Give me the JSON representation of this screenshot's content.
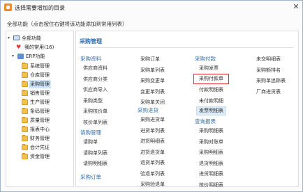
{
  "window": {
    "title": "选择需要增加的目录",
    "close_label": "✕"
  },
  "subtitle": "全部功能（点击按住右键将该功能添加到常用列表）",
  "tree": {
    "root_label": "全部功能",
    "favorites_label": "我的常用(16)",
    "erp_label": "ERP功能",
    "modules": [
      "系统管理",
      "仓库管理",
      "采购管理",
      "销售管理",
      "生产管理",
      "条码管理",
      "质量管理",
      "报表中心",
      "财务管理",
      "会计凭证",
      "资金管理"
    ],
    "selected_index": 2
  },
  "content": {
    "heading": "采购管理",
    "groups": [
      {
        "title": "采购资料",
        "items": [
          "供应商资料",
          "供应商分类",
          "供应商导入",
          "采购类型",
          "采购核价单",
          "核价单列表"
        ]
      },
      {
        "title": "请购管理",
        "items": [
          "请购单",
          "请购单列表",
          "请购明细表"
        ]
      },
      {
        "title": "采购订单",
        "items": []
      },
      {
        "title": "",
        "items": [
          "采购订单",
          "采购单列表",
          "采购变更单",
          "变更单列表",
          "采购单关闭"
        ]
      },
      {
        "title": "采购进货",
        "items": [
          "采购进货单",
          "进货单列表",
          "进货明细表",
          "进货退货单",
          "退货单列表",
          "验退单列表",
          "采购验退单"
        ]
      },
      {
        "title": "采购付款",
        "items": [
          "采购发票",
          "采购付款单",
          "付款明细表",
          "未付款明细",
          "发票明细表"
        ]
      },
      {
        "title": "查询报表",
        "items": [
          "采购明细表",
          "采购对账单",
          "采购明细表",
          "退货明细表",
          "进货明细表",
          "核价明细表"
        ]
      },
      {
        "title": "",
        "items": [
          "未交明细表",
          "采购额排名",
          "采购单追踪表",
          "厂商进货表"
        ]
      }
    ],
    "highlighted_item": "发票明细表",
    "outlined_item": "采购付款单"
  }
}
